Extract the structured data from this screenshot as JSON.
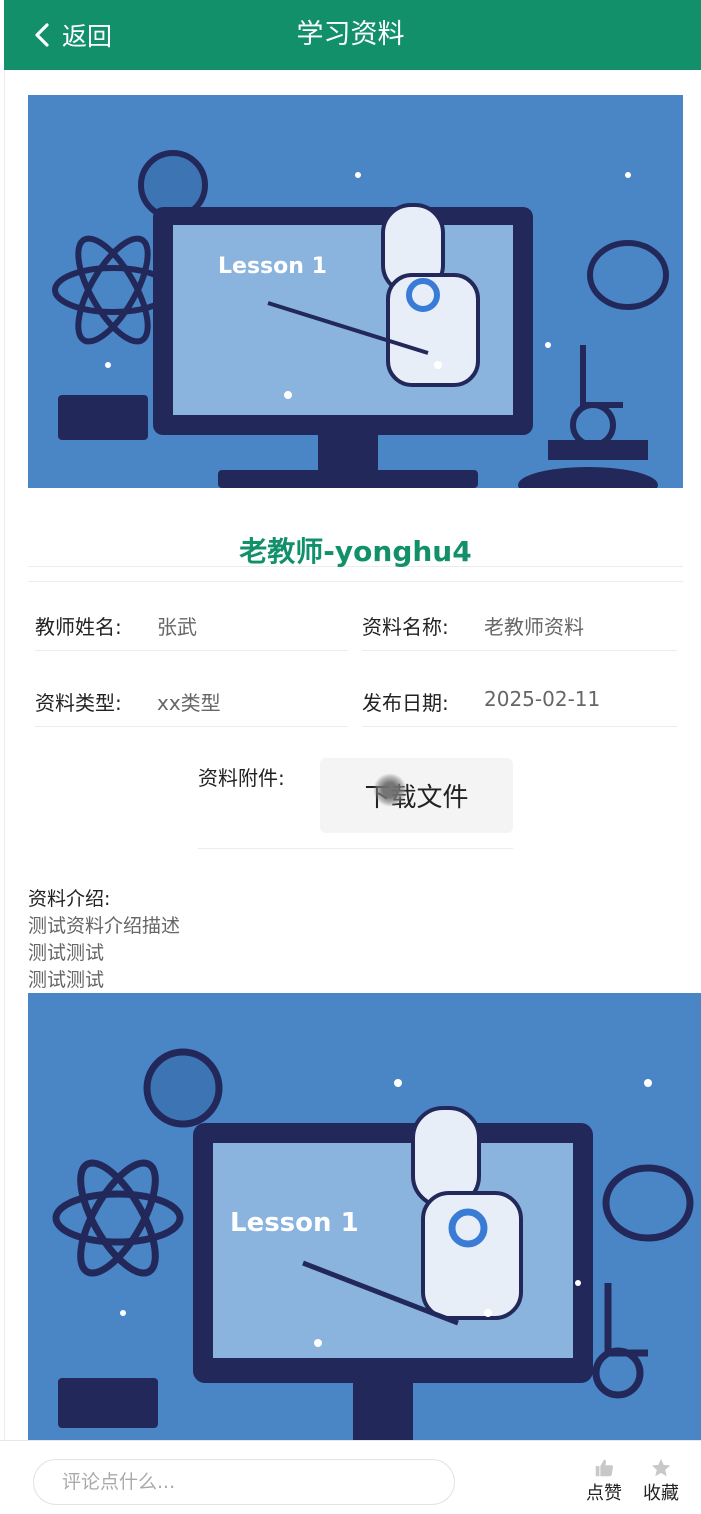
{
  "header": {
    "back_label": "返回",
    "title": "学习资料"
  },
  "banner": {
    "lesson_text": "Lesson 1"
  },
  "detail": {
    "title": "老教师-yonghu4",
    "fields": [
      {
        "label": "教师姓名:",
        "value": "张武"
      },
      {
        "label": "资料名称:",
        "value": "老教师资料"
      },
      {
        "label": "资料类型:",
        "value": "xx类型"
      },
      {
        "label": "发布日期:",
        "value": "2025-02-11"
      }
    ],
    "attachment_label": "资料附件:",
    "download_label": "下载文件",
    "intro_label": "资料介绍:",
    "intro_lines": [
      "测试资料介绍描述",
      "测试测试",
      "测试测试"
    ]
  },
  "footer": {
    "comment_placeholder": "评论点什么...",
    "like_label": "点赞",
    "favorite_label": "收藏"
  },
  "colors": {
    "primary": "#12906a",
    "banner_bg": "#4a86c6",
    "illustration_dark": "#23285a"
  },
  "icons": [
    "chevron-left-icon",
    "thumbs-up-icon",
    "star-icon"
  ]
}
